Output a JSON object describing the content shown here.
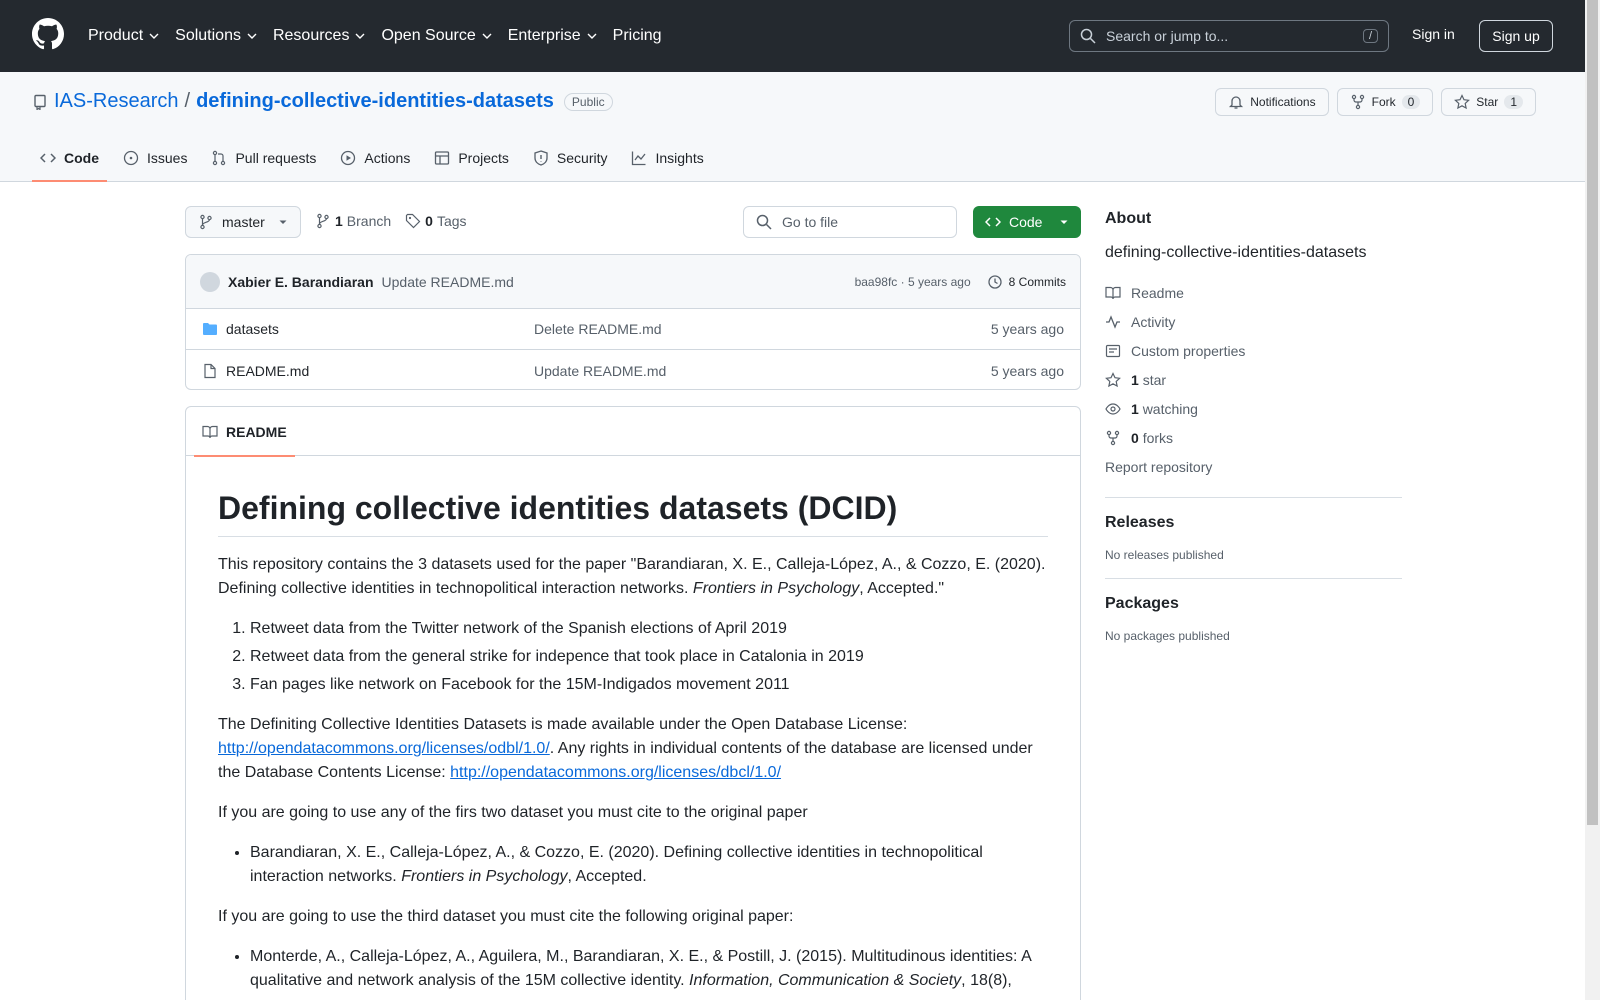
{
  "header": {
    "nav": [
      "Product",
      "Solutions",
      "Resources",
      "Open Source",
      "Enterprise",
      "Pricing"
    ],
    "search_placeholder": "Search or jump to...",
    "search_shortcut": "/",
    "signin": "Sign in",
    "signup": "Sign up"
  },
  "repo": {
    "owner": "IAS-Research",
    "separator": "/",
    "name": "defining-collective-identities-datasets",
    "visibility": "Public",
    "notifications_label": "Notifications",
    "fork_label": "Fork",
    "fork_count": "0",
    "star_label": "Star",
    "star_count": "1"
  },
  "tabs": [
    "Code",
    "Issues",
    "Pull requests",
    "Actions",
    "Projects",
    "Security",
    "Insights"
  ],
  "toolbar": {
    "branch": "master",
    "branch_count": "1",
    "branch_label": "Branch",
    "tag_count": "0",
    "tag_label": "Tags",
    "goto_placeholder": "Go to file",
    "code_button": "Code"
  },
  "commit": {
    "author": "Xabier E. Barandiaran",
    "message": "Update README.md",
    "hash_time": "baa98fc · 5 years ago",
    "commits_label": "8 Commits"
  },
  "files": [
    {
      "name": "datasets",
      "type": "folder",
      "message": "Delete README.md",
      "date": "5 years ago"
    },
    {
      "name": "README.md",
      "type": "file",
      "message": "Update README.md",
      "date": "5 years ago"
    }
  ],
  "readme": {
    "tab": "README",
    "title": "Defining collective identities datasets (DCID)",
    "p1_a": "This repository contains the 3 datasets used for the paper \"Barandiaran, X. E., Calleja-López, A., & Cozzo, E. (2020). Defining collective identities in technopolitical interaction networks. ",
    "p1_em": "Frontiers in Psychology",
    "p1_b": ", Accepted.\"",
    "list1": [
      "Retweet data from the Twitter network of the Spanish elections of April 2019",
      "Retweet data from the general strike for indepence that took place in Catalonia in 2019",
      "Fan pages like network on Facebook for the 15M-Indigados movement 2011"
    ],
    "p2_a": "The Definiting Collective Identities Datasets is made available under the Open Database License: ",
    "p2_link1": "http://opendatacommons.org/licenses/odbl/1.0/",
    "p2_b": ". Any rights in individual contents of the database are licensed under the Database Contents License: ",
    "p2_link2": "http://opendatacommons.org/licenses/dbcl/1.0/",
    "p3": "If you are going to use any of the firs two dataset you must cite to the original paper",
    "cite1_a": "Barandiaran, X. E., Calleja-López, A., & Cozzo, E. (2020). Defining collective identities in technopolitical interaction networks. ",
    "cite1_em": "Frontiers in Psychology",
    "cite1_b": ", Accepted.",
    "p4": "If you are going to use the third dataset you must cite the following original paper:",
    "cite2_a": "Monterde, A., Calleja-López, A., Aguilera, M., Barandiaran, X. E., & Postill, J. (2015). Multitudinous identities: A qualitative and network analysis of the 15M collective identity. ",
    "cite2_em": "Information, Communication & Society",
    "cite2_b": ", 18(8),"
  },
  "sidebar": {
    "about_title": "About",
    "description": "defining-collective-identities-datasets",
    "readme": "Readme",
    "activity": "Activity",
    "custom_properties": "Custom properties",
    "stars_count": "1",
    "stars_label": "star",
    "watching_count": "1",
    "watching_label": "watching",
    "forks_count": "0",
    "forks_label": "forks",
    "report": "Report repository",
    "releases_title": "Releases",
    "releases_text": "No releases published",
    "packages_title": "Packages",
    "packages_text": "No packages published"
  }
}
